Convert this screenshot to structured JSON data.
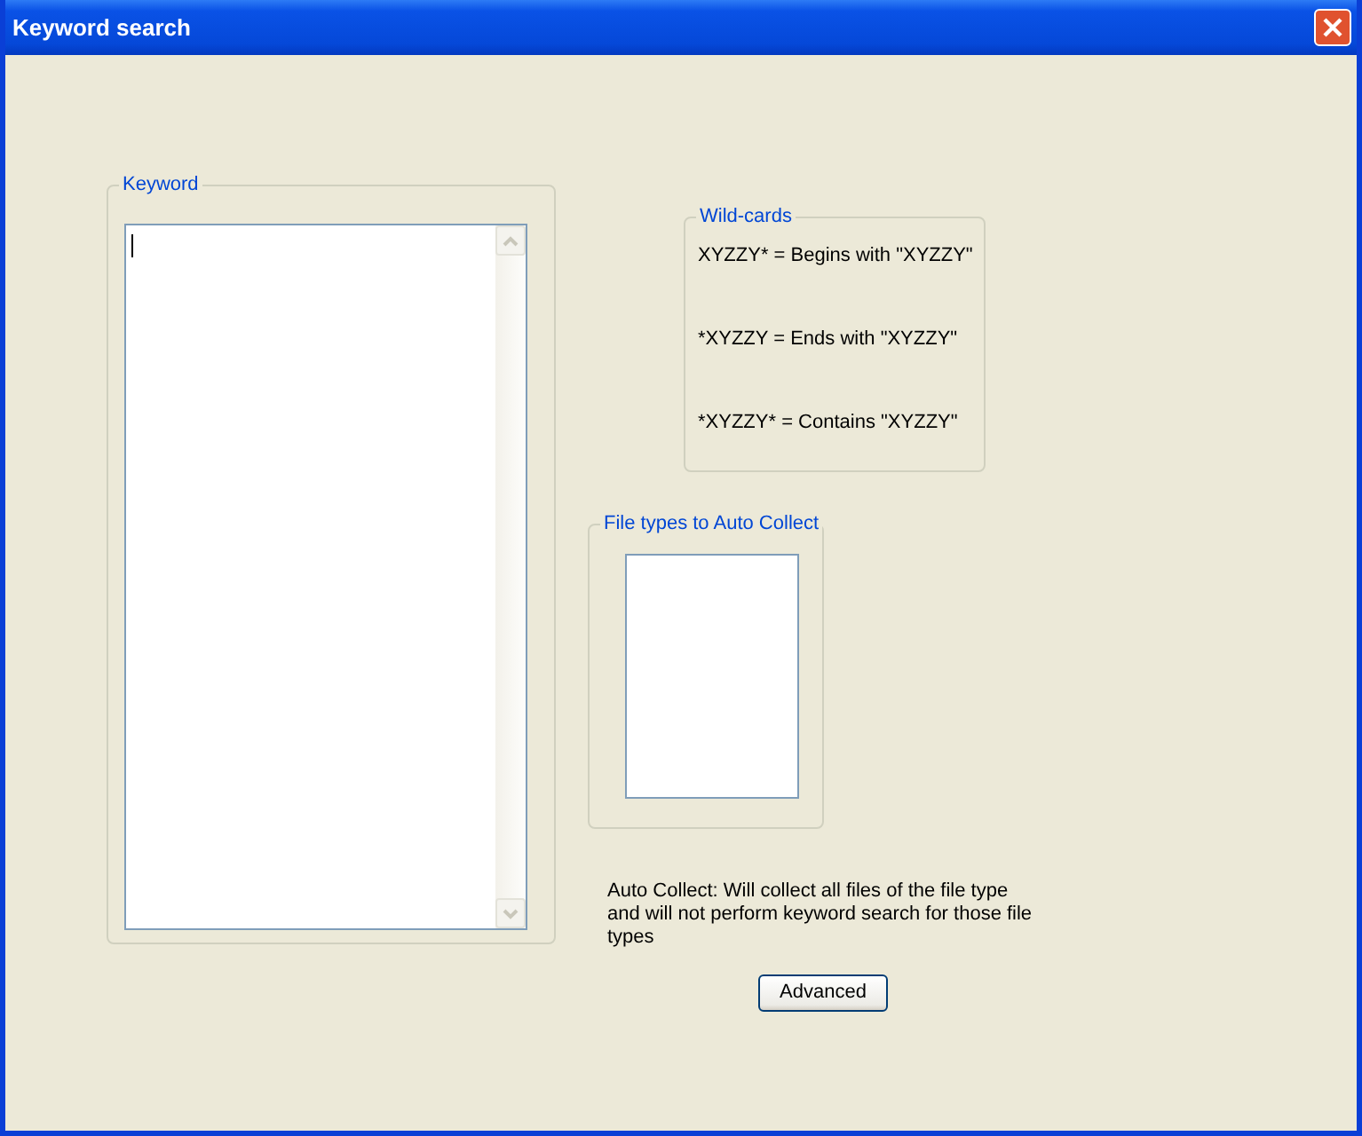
{
  "window": {
    "title": "Keyword search"
  },
  "keyword_group": {
    "label": "Keyword",
    "field": {
      "focused": true
    }
  },
  "wildcards_group": {
    "label": "Wild-cards",
    "lines": [
      "XYZZY* = Begins with \"XYZZY\"",
      "*XYZZY = Ends with \"XYZZY\"",
      "*XYZZY* = Contains \"XYZZY\""
    ]
  },
  "file_types_group": {
    "label": "File types to Auto Collect"
  },
  "note": "Auto Collect: Will collect all files of the file type and will not perform keyword search for those file types",
  "buttons": [
    {
      "label": "Advanced"
    }
  ]
}
